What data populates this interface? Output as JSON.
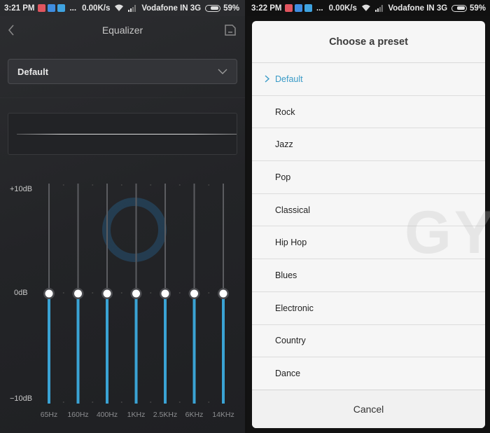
{
  "left": {
    "status": {
      "time": "3:21 PM",
      "speed": "0.00K/s",
      "carrier": "Vodafone IN 3G",
      "battery": "59%",
      "more": "..."
    },
    "title": "Equalizer",
    "preset_value": "Default",
    "db_labels": {
      "top": "+10dB",
      "mid": "0dB",
      "bottom": "−10dB"
    },
    "bands": [
      {
        "freq": "65Hz",
        "gain_db": 0
      },
      {
        "freq": "160Hz",
        "gain_db": 0
      },
      {
        "freq": "400Hz",
        "gain_db": 0
      },
      {
        "freq": "1KHz",
        "gain_db": 0
      },
      {
        "freq": "2.5KHz",
        "gain_db": 0
      },
      {
        "freq": "6KHz",
        "gain_db": 0
      },
      {
        "freq": "14KHz",
        "gain_db": 0
      }
    ],
    "gain_range_db": [
      -10,
      10
    ],
    "accent": "#3aa3d4"
  },
  "right": {
    "status": {
      "time": "3:22 PM",
      "speed": "0.00K/s",
      "carrier": "Vodafone IN 3G",
      "battery": "59%",
      "more": "..."
    },
    "dialog_title": "Choose a preset",
    "presets": [
      "Default",
      "Rock",
      "Jazz",
      "Pop",
      "Classical",
      "Hip Hop",
      "Blues",
      "Electronic",
      "Country",
      "Dance"
    ],
    "selected": "Default",
    "cancel_label": "Cancel",
    "accent": "#3a9bc7"
  },
  "watermark": "GYAAN",
  "icons": {
    "back": "chevron-left-icon",
    "save": "save-icon",
    "dropdown": "chevron-down-icon"
  }
}
